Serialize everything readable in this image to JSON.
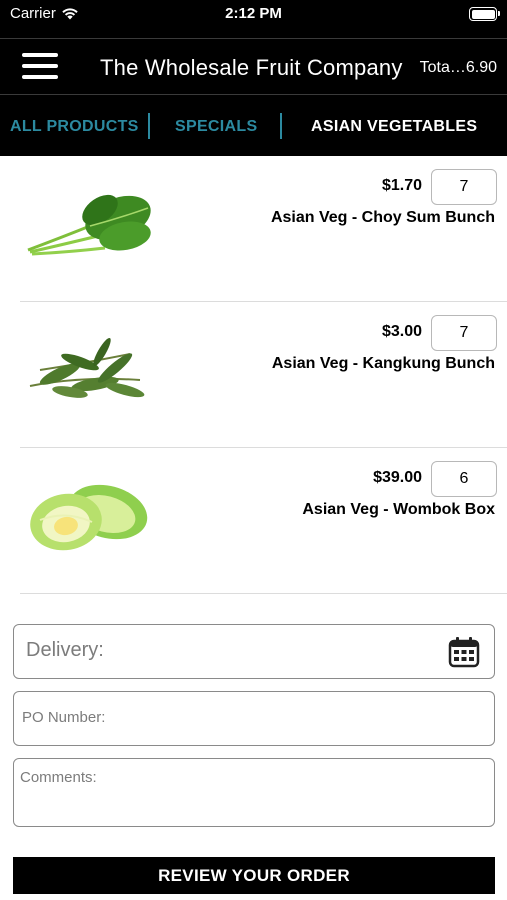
{
  "status_bar": {
    "carrier": "Carrier",
    "time": "2:12 PM"
  },
  "header": {
    "title": "The Wholesale Fruit Company",
    "total": "Tota…6.90"
  },
  "tabs": [
    {
      "label": "ALL PRODUCTS",
      "active": false
    },
    {
      "label": "SPECIALS",
      "active": false
    },
    {
      "label": "ASIAN VEGETABLES",
      "active": true
    }
  ],
  "products": [
    {
      "name": "Asian Veg - Choy Sum Bunch",
      "price": "$1.70",
      "quantity": "7",
      "image_icon": "choy-sum-icon"
    },
    {
      "name": "Asian Veg - Kangkung Bunch",
      "price": "$3.00",
      "quantity": "7",
      "image_icon": "kangkung-icon"
    },
    {
      "name": "Asian Veg - Wombok Box",
      "price": "$39.00",
      "quantity": "6",
      "image_icon": "wombok-icon"
    }
  ],
  "form": {
    "delivery_placeholder": "Delivery:",
    "po_placeholder": "PO Number:",
    "comments_placeholder": "Comments:"
  },
  "review_button": "REVIEW YOUR ORDER",
  "colors": {
    "accent": "#2c8aa0",
    "bar_background": "#000000"
  }
}
